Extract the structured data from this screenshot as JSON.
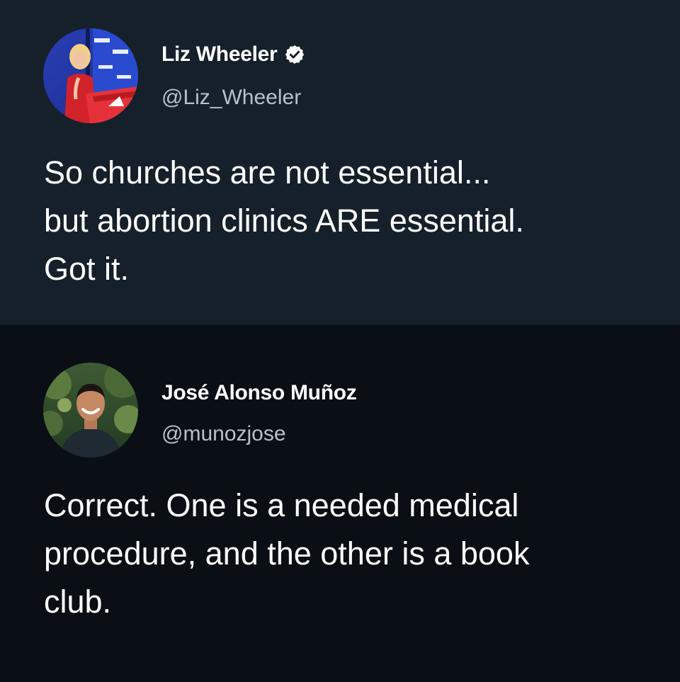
{
  "tweets": [
    {
      "display_name": "Liz Wheeler",
      "verified": true,
      "handle": "@Liz_Wheeler",
      "avatar_icon": "avatar-photo-speaker-at-podium",
      "text": "So churches are not essential...\nbut abortion clinics ARE essential.\nGot it.",
      "background": "#15202b"
    },
    {
      "display_name": "José Alonso Muñoz",
      "verified": false,
      "handle": "@munozjose",
      "avatar_icon": "avatar-photo-smiling-man-outdoors",
      "text": "Correct. One is a needed medical\nprocedure, and the other is a book\nclub.",
      "background": "#0a0f15"
    }
  ],
  "colors": {
    "text_primary": "#ffffff",
    "text_secondary": "#b7c1cb",
    "verified_badge": "#ffffff"
  }
}
